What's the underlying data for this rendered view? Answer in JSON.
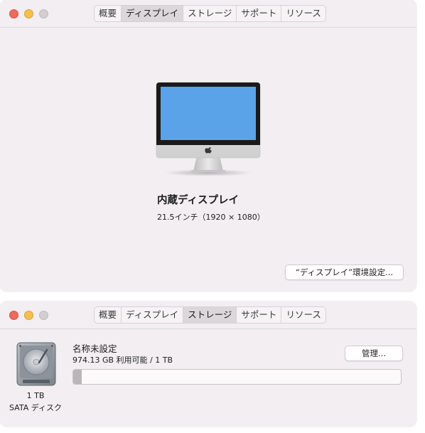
{
  "display_window": {
    "tabs": [
      {
        "label": "概要",
        "active": false
      },
      {
        "label": "ディスプレイ",
        "active": true
      },
      {
        "label": "ストレージ",
        "active": false
      },
      {
        "label": "サポート",
        "active": false
      },
      {
        "label": "リソース",
        "active": false
      }
    ],
    "title": "内蔵ディスプレイ",
    "subtitle": "21.5インチ（1920 × 1080）",
    "prefs_button": "“ディスプレイ”環境設定..."
  },
  "storage_window": {
    "tabs": [
      {
        "label": "概要",
        "active": false
      },
      {
        "label": "ディスプレイ",
        "active": false
      },
      {
        "label": "ストレージ",
        "active": true
      },
      {
        "label": "サポート",
        "active": false
      },
      {
        "label": "リソース",
        "active": false
      }
    ],
    "disk_size": "1 TB",
    "disk_type": "SATA ディスク",
    "volume_name": "名称未設定",
    "available": "974.13 GB 利用可能 / 1 TB",
    "manage_button": "管理...",
    "used_fraction": 0.025
  },
  "colors": {
    "screen": "#5aa3e8",
    "close": "#ed6a5e",
    "minimize": "#f5bf4f"
  },
  "icons": {
    "device": "imac-icon",
    "disk": "hard-disk-icon"
  }
}
